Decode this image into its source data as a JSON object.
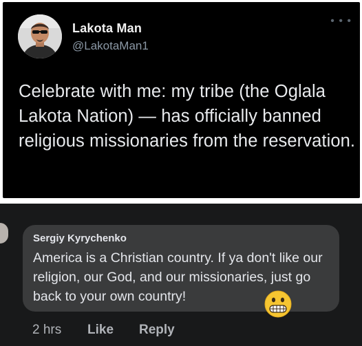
{
  "tweet": {
    "display_name": "Lakota Man",
    "handle": "@LakotaMan1",
    "more_icon": "ellipsis-icon",
    "text": "Celebrate with me: my tribe (the Oglala Lakota Nation) — has officially banned religious missionaries from the reservation.",
    "colors": {
      "background": "#000000",
      "text": "#e8eaed",
      "handle": "#8b98a5"
    }
  },
  "comment": {
    "author": "Sergiy Kyrychenko",
    "text": "America is a Christian country. If ya don't like our religion, our God, and our missionaries, just go back to your own country!",
    "emoji": "grimacing-face-icon",
    "actions": {
      "time": "2 hrs",
      "like": "Like",
      "reply": "Reply"
    },
    "colors": {
      "background": "#18191a",
      "bubble": "#3a3b3c",
      "text": "#e4e6eb",
      "muted": "#b0b3b8"
    }
  }
}
